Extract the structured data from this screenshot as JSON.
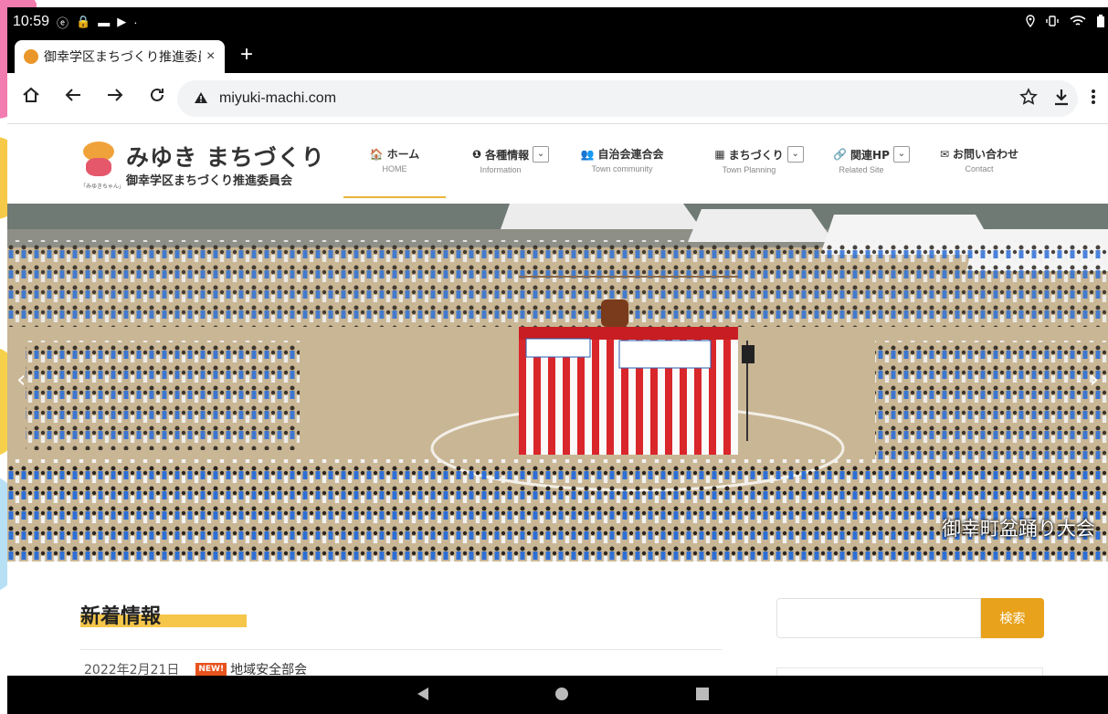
{
  "statusbar": {
    "time": "10:59",
    "icons": [
      "ⓔ",
      "🔒",
      "▬",
      "▶",
      "·"
    ],
    "right_icons": [
      "location-icon",
      "vibrate-icon",
      "wifi-icon",
      "battery-icon"
    ]
  },
  "browser": {
    "tab_title": "御幸学区まちづくり推進委員会",
    "tab_close": "×",
    "new_tab": "+",
    "url": "miyuki-machi.com"
  },
  "site": {
    "logo_title": "みゆき まちづくり",
    "logo_subtitle": "御幸学区まちづくり推進委員会",
    "logo_caption": "「みゆきちゃん」",
    "nav": [
      {
        "label": "ホーム",
        "sub": "HOME",
        "icon": "🏠",
        "has_dropdown": false
      },
      {
        "label": "各種情報",
        "sub": "Information",
        "icon": "❶",
        "has_dropdown": true
      },
      {
        "label": "自治会連合会",
        "sub": "Town community",
        "icon": "👥",
        "has_dropdown": false
      },
      {
        "label": "まちづくり",
        "sub": "Town Planning",
        "icon": "▦",
        "has_dropdown": true
      },
      {
        "label": "関連HP",
        "sub": "Related Site",
        "icon": "🔗",
        "has_dropdown": true
      },
      {
        "label": "お問い合わせ",
        "sub": "Contact",
        "icon": "✉",
        "has_dropdown": false
      }
    ],
    "dropdown_glyph": "⌄"
  },
  "hero": {
    "caption": "御幸町盆踊り大会",
    "prev": "‹",
    "next": "›"
  },
  "news": {
    "heading": "新着情報",
    "items": [
      {
        "date": "2022年2月21日",
        "badge": "NEW!",
        "title": "地域安全部会"
      }
    ]
  },
  "search": {
    "button_label": "検索",
    "value": ""
  },
  "colors": {
    "accent": "#e8a21b",
    "heading_bar": "#f5c64a",
    "badge": "#e8531d"
  }
}
